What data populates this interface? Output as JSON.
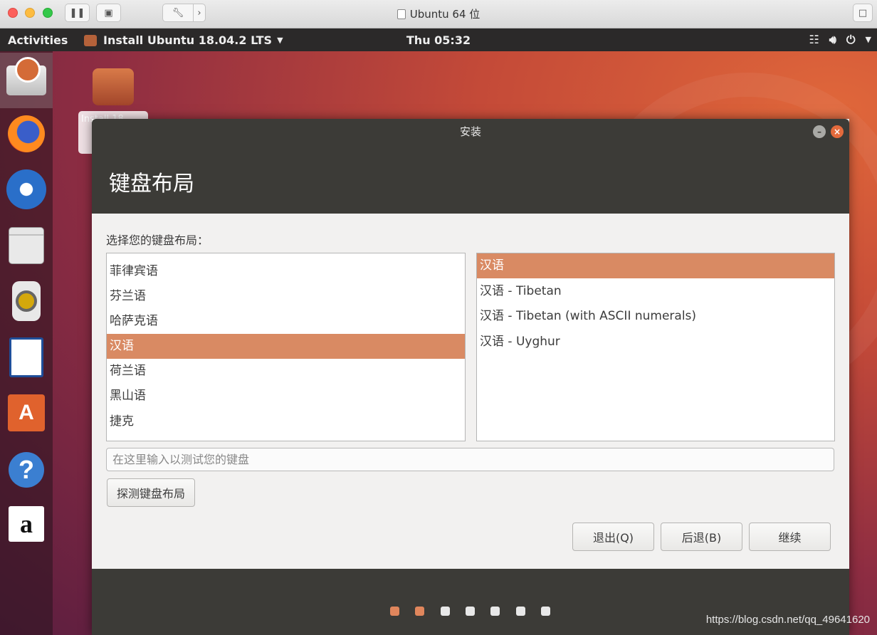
{
  "host": {
    "title": "Ubuntu 64 位",
    "toolbar": [
      "pause-icon",
      "snapshot-icon",
      "wrench-icon",
      "chevron-right-icon",
      "fullscreen-icon"
    ]
  },
  "top_panel": {
    "activities": "Activities",
    "app_menu": "Install Ubuntu 18.04.2 LTS",
    "clock": "Thu 05:32",
    "tray": [
      "network-icon",
      "volume-icon",
      "power-icon",
      "chevron-down-icon"
    ]
  },
  "dock": [
    "installer-icon",
    "firefox-icon",
    "thunderbird-icon",
    "files-icon",
    "rhythmbox-icon",
    "writer-icon",
    "software-center-icon",
    "help-icon",
    "amazon-icon"
  ],
  "desktop_icon": {
    "label": "Install 18..."
  },
  "window": {
    "title": "安装",
    "page_heading": "键盘布局",
    "prompt": "选择您的键盘布局：",
    "layouts": [
      {
        "label": "菲律宾语",
        "selected": false
      },
      {
        "label": "芬兰语",
        "selected": false
      },
      {
        "label": "哈萨克语",
        "selected": false
      },
      {
        "label": "汉语",
        "selected": true
      },
      {
        "label": "荷兰语",
        "selected": false
      },
      {
        "label": "黑山语",
        "selected": false
      },
      {
        "label": "捷克",
        "selected": false
      }
    ],
    "variants": [
      {
        "label": "汉语",
        "selected": true
      },
      {
        "label": "汉语 - Tibetan",
        "selected": false
      },
      {
        "label": "汉语 - Tibetan (with ASCII numerals)",
        "selected": false
      },
      {
        "label": "汉语 - Uyghur",
        "selected": false
      }
    ],
    "test_placeholder": "在这里输入以测试您的键盘",
    "detect_button": "探测键盘布局",
    "quit_button": "退出(Q)",
    "back_button": "后退(B)",
    "continue_button": "继续",
    "progress": {
      "steps_total": 7,
      "steps_done": 2
    }
  },
  "watermark": "https://blog.csdn.net/qq_49641620",
  "colors": {
    "selection": "#d98a63",
    "accent": "#e46a3c",
    "header": "#3c3b37"
  }
}
